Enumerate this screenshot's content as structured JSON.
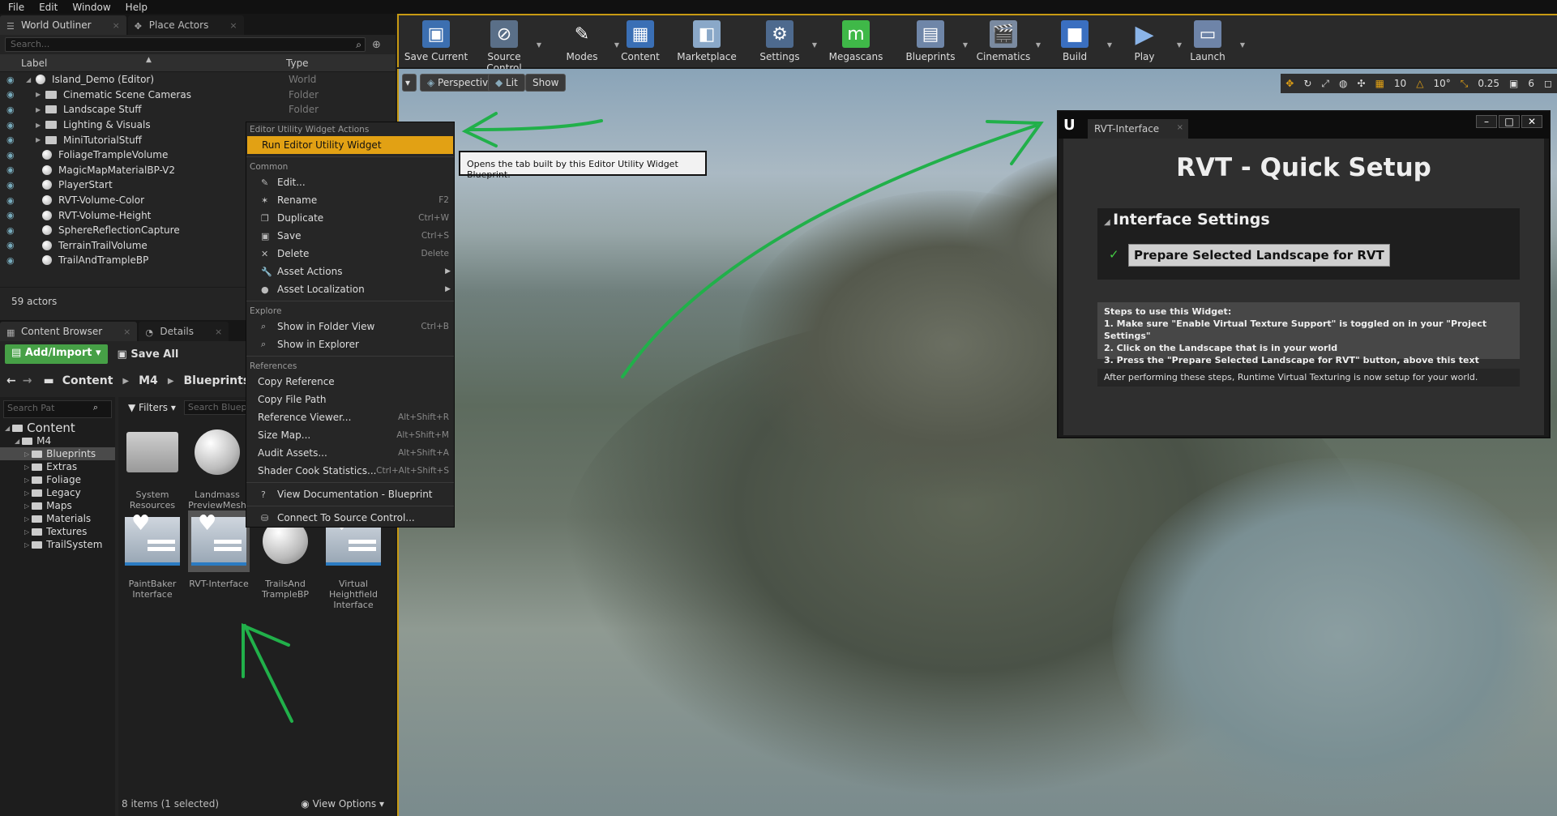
{
  "menu": [
    "File",
    "Edit",
    "Window",
    "Help"
  ],
  "outliner": {
    "tab_label": "World Outliner",
    "tab2_label": "Place Actors",
    "search_placeholder": "Search...",
    "col_label": "Label",
    "col_type": "Type",
    "rows": [
      {
        "name": "Island_Demo (Editor)",
        "type": "World",
        "icon": "world-icon"
      },
      {
        "name": "Cinematic Scene Cameras",
        "type": "Folder",
        "icon": "folder-icon"
      },
      {
        "name": "Landscape Stuff",
        "type": "Folder",
        "icon": "folder-icon"
      },
      {
        "name": "Lighting & Visuals",
        "type": "",
        "icon": "folder-icon"
      },
      {
        "name": "MiniTutorialStuff",
        "type": "",
        "icon": "folder-icon"
      },
      {
        "name": "FoliageTrampleVolume",
        "type": "",
        "icon": "actor-icon"
      },
      {
        "name": "MagicMapMaterialBP-V2",
        "type": "",
        "icon": "actor-icon"
      },
      {
        "name": "PlayerStart",
        "type": "",
        "icon": "actor-icon"
      },
      {
        "name": "RVT-Volume-Color",
        "type": "",
        "icon": "actor-icon"
      },
      {
        "name": "RVT-Volume-Height",
        "type": "",
        "icon": "actor-icon"
      },
      {
        "name": "SphereReflectionCapture",
        "type": "",
        "icon": "actor-icon"
      },
      {
        "name": "TerrainTrailVolume",
        "type": "",
        "icon": "actor-icon"
      },
      {
        "name": "TrailAndTrampleBP",
        "type": "",
        "icon": "actor-icon"
      }
    ],
    "actor_count": "59 actors"
  },
  "content_browser": {
    "tab_label": "Content Browser",
    "tab2_label": "Details",
    "add_import": "Add/Import",
    "save_all": "Save All",
    "path": [
      "Content",
      "M4",
      "Blueprints"
    ],
    "search_paths_placeholder": "Search Pat",
    "filters": "Filters",
    "search_bp_placeholder": "Search Blueprints",
    "tree": [
      {
        "label": "Content",
        "level": 0,
        "sel": false
      },
      {
        "label": "M4",
        "level": 1,
        "sel": false
      },
      {
        "label": "Blueprints",
        "level": 2,
        "sel": true
      },
      {
        "label": "Extras",
        "level": 2,
        "sel": false
      },
      {
        "label": "Foliage",
        "level": 2,
        "sel": false
      },
      {
        "label": "Legacy",
        "level": 2,
        "sel": false
      },
      {
        "label": "Maps",
        "level": 2,
        "sel": false
      },
      {
        "label": "Materials",
        "level": 2,
        "sel": false
      },
      {
        "label": "Textures",
        "level": 2,
        "sel": false
      },
      {
        "label": "TrailSystem",
        "level": 2,
        "sel": false
      }
    ],
    "assets": [
      {
        "label": "System Resources"
      },
      {
        "label": "Landmass PreviewMesh"
      },
      {
        "label": "PaintBaker Interface"
      },
      {
        "label": "RVT-Interface"
      },
      {
        "label": "TrailsAnd TrampleBP"
      },
      {
        "label": "Virtual Heightfield Interface"
      }
    ],
    "items_status": "8 items (1 selected)",
    "view_options": "View Options"
  },
  "toolbar": {
    "buttons": [
      "Save Current",
      "Source Control",
      "Modes",
      "Content",
      "Marketplace",
      "Settings",
      "Megascans",
      "Blueprints",
      "Cinematics",
      "Build",
      "Play",
      "Launch"
    ]
  },
  "viewport": {
    "perspective": "Perspective",
    "lit": "Lit",
    "show": "Show",
    "grid_snap": "10",
    "rot_snap": "10°",
    "scale_snap": "0.25",
    "cam_speed": "6"
  },
  "context_menu": {
    "sec_editor": "Editor Utility Widget Actions",
    "run": "Run Editor Utility Widget",
    "sec_common": "Common",
    "common": [
      {
        "label": "Edit...",
        "sc": ""
      },
      {
        "label": "Rename",
        "sc": "F2"
      },
      {
        "label": "Duplicate",
        "sc": "Ctrl+W"
      },
      {
        "label": "Save",
        "sc": "Ctrl+S"
      },
      {
        "label": "Delete",
        "sc": "Delete"
      },
      {
        "label": "Asset Actions",
        "sc": ""
      },
      {
        "label": "Asset Localization",
        "sc": ""
      }
    ],
    "sec_explore": "Explore",
    "explore": [
      {
        "label": "Show in Folder View",
        "sc": "Ctrl+B"
      },
      {
        "label": "Show in Explorer",
        "sc": ""
      }
    ],
    "sec_refs": "References",
    "refs": [
      {
        "label": "Copy Reference",
        "sc": ""
      },
      {
        "label": "Copy File Path",
        "sc": ""
      },
      {
        "label": "Reference Viewer...",
        "sc": "Alt+Shift+R"
      },
      {
        "label": "Size Map...",
        "sc": "Alt+Shift+M"
      },
      {
        "label": "Audit Assets...",
        "sc": "Alt+Shift+A"
      },
      {
        "label": "Shader Cook Statistics...",
        "sc": "Ctrl+Alt+Shift+S"
      }
    ],
    "docs": "View Documentation - Blueprint",
    "source_control": "Connect To Source Control...",
    "tooltip": "Opens the tab built by this Editor Utility Widget Blueprint."
  },
  "rvt": {
    "tab": "RVT-Interface",
    "title": "RVT - Quick Setup",
    "section": "Interface Settings",
    "button": "Prepare Selected Landscape for RVT",
    "steps_title": "Steps to use this Widget:",
    "step1": "1. Make sure \"Enable Virtual Texture Support\" is toggled on in your \"Project Settings\"",
    "step2": "2. Click on the Landscape that is in your world",
    "step3": "3. Press the \"Prepare Selected Landscape for RVT\" button, above this text",
    "after": "After performing these steps, Runtime Virtual Texturing is now setup for your world."
  }
}
